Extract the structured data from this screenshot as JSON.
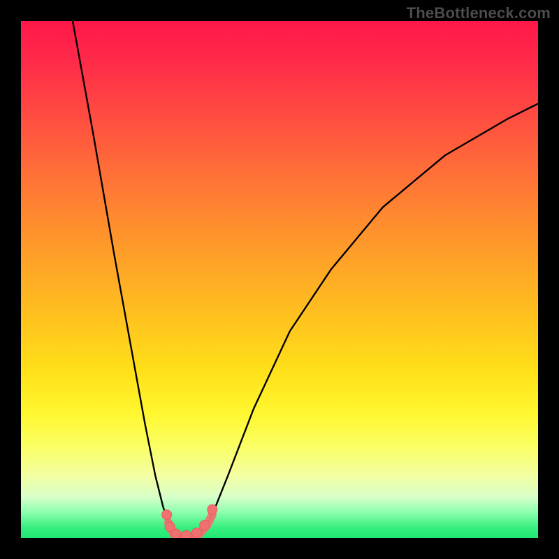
{
  "watermark": "TheBottleneck.com",
  "colors": {
    "frame": "#000000",
    "curve": "#000000",
    "marker_fill": "#f07171",
    "marker_stroke": "#e85c5c"
  },
  "chart_data": {
    "type": "line",
    "title": "",
    "xlabel": "",
    "ylabel": "",
    "xlim": [
      0,
      100
    ],
    "ylim": [
      0,
      100
    ],
    "note": "axes have no visible ticks or labels; values are estimated from pixel positions on a 0–100 scale for both axes",
    "series": [
      {
        "name": "left-branch",
        "x": [
          10,
          14,
          18,
          22,
          24,
          26,
          27.5,
          28.5
        ],
        "y": [
          100,
          78,
          55,
          33,
          22,
          12,
          6,
          3
        ]
      },
      {
        "name": "trough",
        "x": [
          28.5,
          29.5,
          31,
          33,
          34.5,
          36,
          37
        ],
        "y": [
          3,
          0.8,
          0.3,
          0.3,
          0.8,
          2.5,
          4.5
        ]
      },
      {
        "name": "right-branch",
        "x": [
          37,
          40,
          45,
          52,
          60,
          70,
          82,
          94,
          100
        ],
        "y": [
          4.5,
          12,
          25,
          40,
          52,
          64,
          74,
          81,
          84
        ]
      }
    ],
    "markers": {
      "name": "trough-markers",
      "points": [
        {
          "x": 28.2,
          "y": 4.5
        },
        {
          "x": 28.8,
          "y": 2.2
        },
        {
          "x": 30.0,
          "y": 0.8
        },
        {
          "x": 32.0,
          "y": 0.5
        },
        {
          "x": 34.0,
          "y": 1.0
        },
        {
          "x": 35.5,
          "y": 2.5
        },
        {
          "x": 37.0,
          "y": 5.5
        }
      ]
    }
  }
}
